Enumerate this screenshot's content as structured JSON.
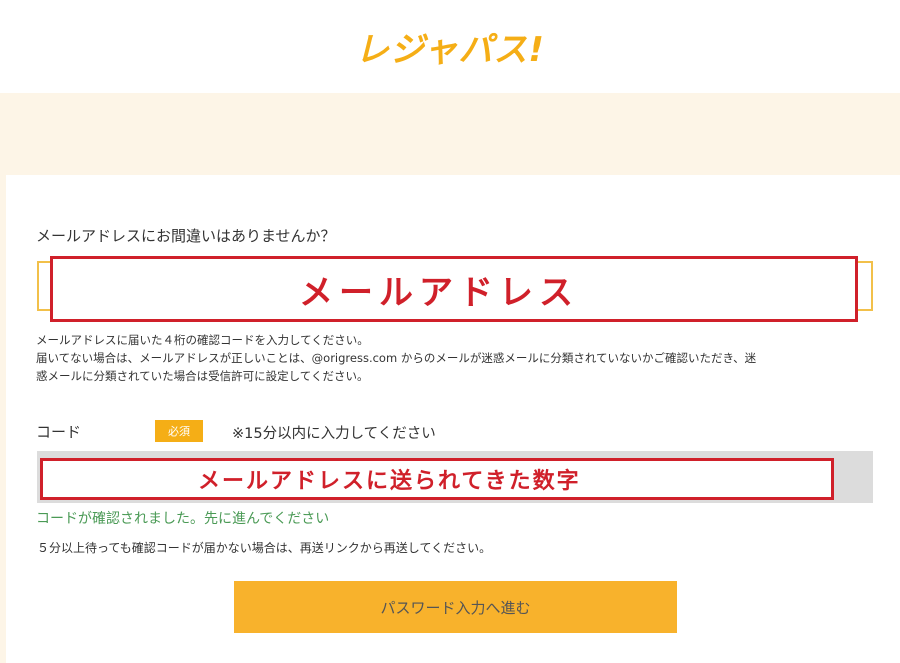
{
  "header": {
    "logo_text": "レジャパス!"
  },
  "form": {
    "question": "メールアドレスにお間違いはありませんか？",
    "email_annotation": "メールアドレス",
    "instructions": [
      "メールアドレスに届いた４桁の確認コードを入力してください。",
      "届いてない場合は、メールアドレスが正しいことは、@origress.com からのメールが迷惑メールに分類されていないかご確認いただき、迷",
      "惑メールに分類されていた場合は受信許可に設定してください。"
    ],
    "code_label": "コード",
    "required_badge": "必須",
    "code_note": "※15分以内に入力してください",
    "code_annotation": "メールアドレスに送られてきた数字",
    "success_message": "コードが確認されました。先に進んでください",
    "resend_note": "５分以上待っても確認コードが届かない場合は、再送リンクから再送してください。",
    "submit_label": "パスワード入力へ進む"
  },
  "colors": {
    "brand": "#f5ae16",
    "button": "#f8b22c",
    "page_background": "#fdf5e7",
    "annotation_red": "#d0202a",
    "success_green": "#4a9a55"
  }
}
